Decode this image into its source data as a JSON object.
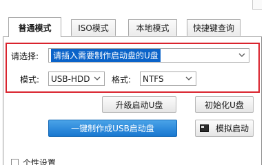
{
  "tabs": [
    {
      "label": "普通模式",
      "active": true
    },
    {
      "label": "ISO模式",
      "active": false
    },
    {
      "label": "本地模式",
      "active": false
    },
    {
      "label": "快捷键查询",
      "active": false
    }
  ],
  "select_disk": {
    "label": "请选择:",
    "value": "请插入需要制作启动盘的U盘"
  },
  "mode": {
    "label": "模式:",
    "value": "USB-HDD"
  },
  "format": {
    "label": "格式:",
    "value": "NTFS"
  },
  "buttons": {
    "upgrade": "升级启动U盘",
    "init": "初始化U盘",
    "make": "一键制作成USB启动盘",
    "simulate": "模拟启动"
  },
  "personal_settings": "个性设置",
  "colors": {
    "highlight_box": "#d9232d",
    "primary_button": "#1877d0",
    "selection": "#0a63c9"
  }
}
